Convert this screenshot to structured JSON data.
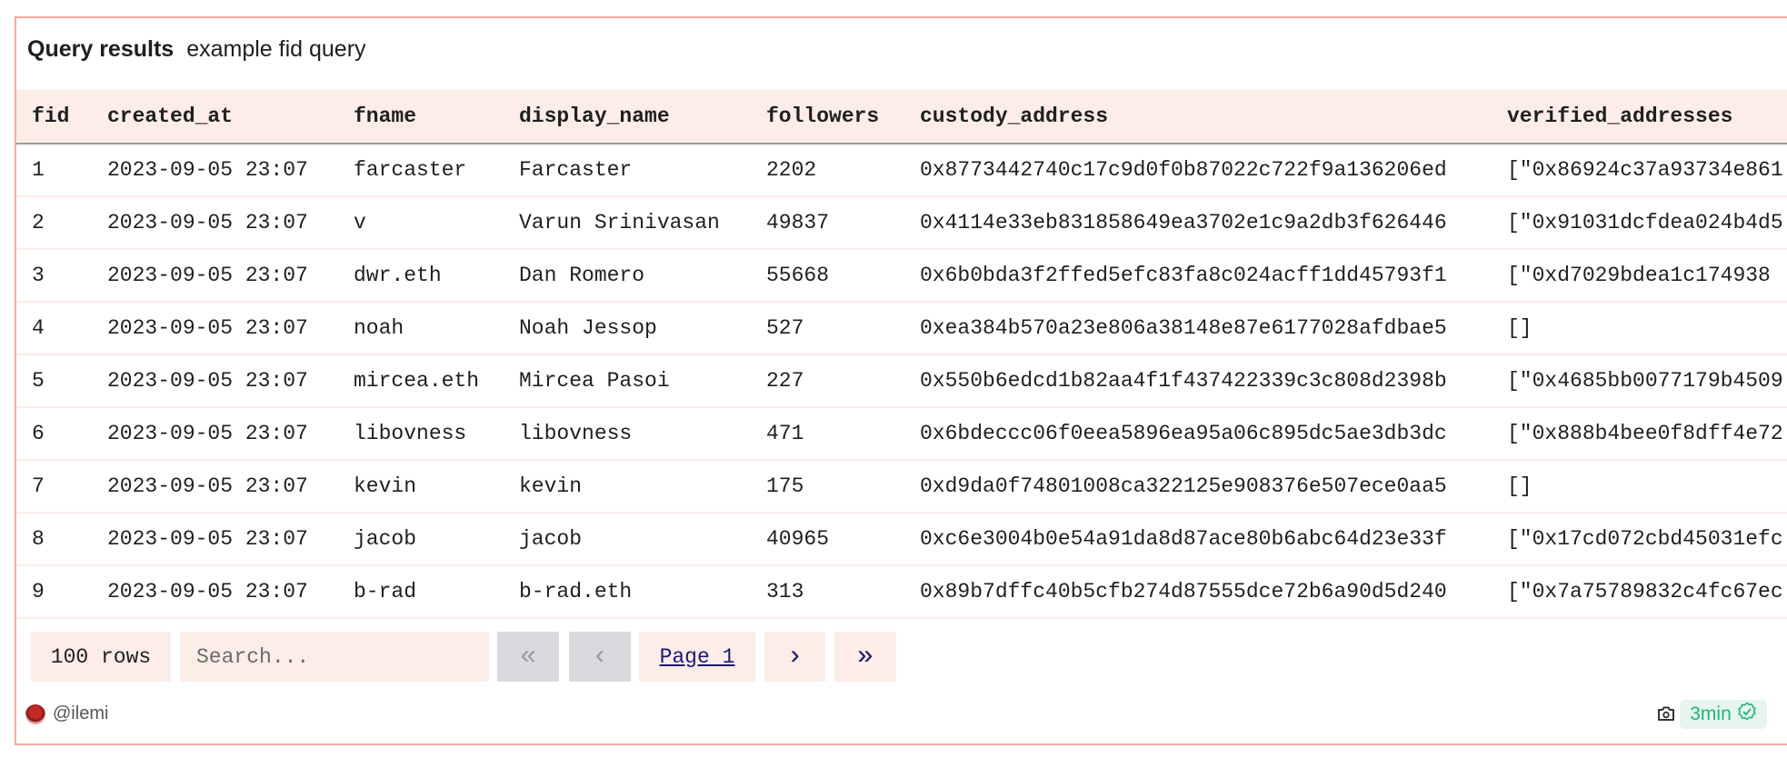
{
  "header": {
    "title": "Query results",
    "query_name": "example fid query"
  },
  "table": {
    "columns": [
      "fid",
      "created_at",
      "fname",
      "display_name",
      "followers",
      "custody_address",
      "verified_addresses"
    ],
    "rows": [
      [
        "1",
        "2023-09-05 23:07",
        "farcaster",
        "Farcaster",
        "2202",
        "0x8773442740c17c9d0f0b87022c722f9a136206ed",
        "[\"0x86924c37a93734e861"
      ],
      [
        "2",
        "2023-09-05 23:07",
        "v",
        "Varun Srinivasan",
        "49837",
        "0x4114e33eb831858649ea3702e1c9a2db3f626446",
        "[\"0x91031dcfdea024b4d5"
      ],
      [
        "3",
        "2023-09-05 23:07",
        "dwr.eth",
        "Dan Romero",
        "55668",
        "0x6b0bda3f2ffed5efc83fa8c024acff1dd45793f1",
        "[\"0xd7029bdea1c174938"
      ],
      [
        "4",
        "2023-09-05 23:07",
        "noah",
        "Noah Jessop",
        "527",
        "0xea384b570a23e806a38148e87e6177028afdbae5",
        "[]"
      ],
      [
        "5",
        "2023-09-05 23:07",
        "mircea.eth",
        "Mircea Pasoi",
        "227",
        "0x550b6edcd1b82aa4f1f437422339c3c808d2398b",
        "[\"0x4685bb0077179b4509"
      ],
      [
        "6",
        "2023-09-05 23:07",
        "libovness",
        "libovness",
        "471",
        "0x6bdeccc06f0eea5896ea95a06c895dc5ae3db3dc",
        "[\"0x888b4bee0f8dff4e72"
      ],
      [
        "7",
        "2023-09-05 23:07",
        "kevin",
        "kevin",
        "175",
        "0xd9da0f74801008ca322125e908376e507ece0aa5",
        "[]"
      ],
      [
        "8",
        "2023-09-05 23:07",
        "jacob",
        "jacob",
        "40965",
        "0xc6e3004b0e54a91da8d87ace80b6abc64d23e33f",
        "[\"0x17cd072cbd45031efc"
      ],
      [
        "9",
        "2023-09-05 23:07",
        "b-rad",
        "b-rad.eth",
        "313",
        "0x89b7dffc40b5cfb274d87555dce72b6a90d5d240",
        "[\"0x7a75789832c4fc67ec"
      ]
    ]
  },
  "footer": {
    "row_count": "100 rows",
    "search_placeholder": "Search...",
    "first_icon": "«",
    "prev_icon": "‹",
    "page_label": "Page 1",
    "next_icon": "›",
    "last_icon": "»",
    "author": "@ilemi",
    "refresh_age": "3min"
  },
  "colors": {
    "border": "#f4ab99",
    "header_bg": "#fcede9",
    "accent_link": "#1c1a6e",
    "badge_green": "#22b573"
  }
}
